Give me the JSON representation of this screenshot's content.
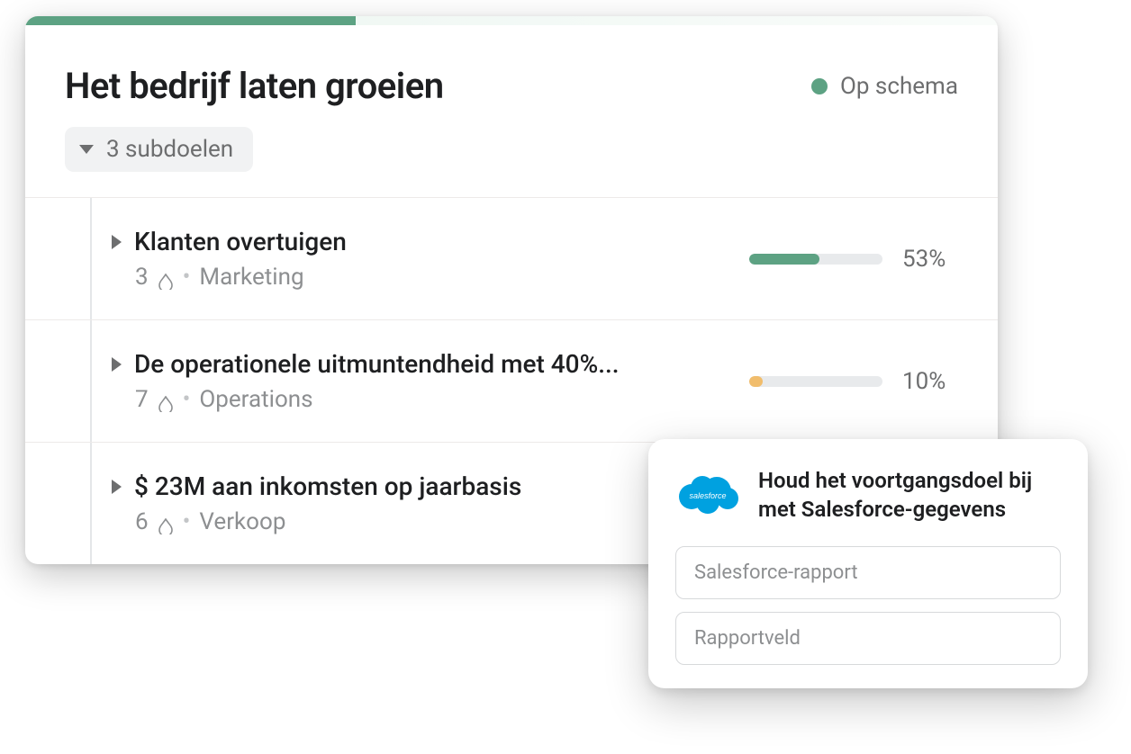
{
  "goal": {
    "title": "Het bedrijf laten groeien",
    "status_label": "Op schema",
    "status_color": "#5da283",
    "progress_strip_pct": 34,
    "subgoals_chip": "3 subdoelen"
  },
  "subgoals": [
    {
      "title": "Klanten overtuigen",
      "count": "3",
      "team": "Marketing",
      "pct_label": "53%",
      "pct": 53,
      "bar_color": "#5da283"
    },
    {
      "title": "De operationele uitmuntendheid met 40%...",
      "count": "7",
      "team": "Operations",
      "pct_label": "10%",
      "pct": 10,
      "bar_color": "#f1bd6c"
    },
    {
      "title": "$ 23M aan inkomsten op jaarbasis",
      "count": "6",
      "team": "Verkoop",
      "pct_label": "",
      "pct": 0,
      "bar_color": ""
    }
  ],
  "popover": {
    "title": "Houd het voortgangsdoel bij met Salesforce-gegevens",
    "field1_placeholder": "Salesforce-rapport",
    "field2_placeholder": "Rapportveld",
    "logo_label": "salesforce"
  }
}
